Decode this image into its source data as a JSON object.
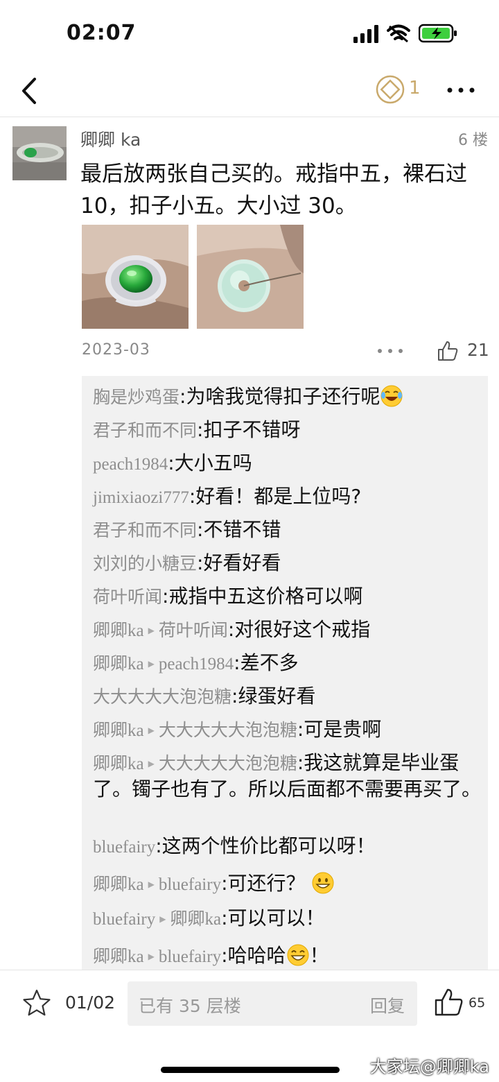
{
  "status": {
    "time": "02:07"
  },
  "nav": {
    "coin_count": "1"
  },
  "post": {
    "username": "卿卿 ka",
    "floor": "6 楼",
    "text": "最后放两张自己买的。戒指中五，裸石过 10，扣子小五。大小过 30。",
    "date": "2023-03",
    "likes": "21"
  },
  "replies": [
    {
      "from": "胸是炒鸡蛋",
      "to": "",
      "text": "为啥我觉得扣子还行呢",
      "emoji": "laugh-cry"
    },
    {
      "from": "君子和而不同",
      "to": "",
      "text": "扣子不错呀",
      "emoji": ""
    },
    {
      "from": "peach1984",
      "to": "",
      "text": "大小五吗",
      "emoji": ""
    },
    {
      "from": "jimixiaozi777",
      "to": "",
      "text": "好看！都是上位吗?",
      "emoji": ""
    },
    {
      "from": "君子和而不同",
      "to": "",
      "text": "不错不错",
      "emoji": ""
    },
    {
      "from": "刘刘的小糖豆",
      "to": "",
      "text": "好看好看",
      "emoji": ""
    },
    {
      "from": "荷叶听闻",
      "to": "",
      "text": "戒指中五这价格可以啊",
      "emoji": ""
    },
    {
      "from": "卿卿ka",
      "to": "荷叶听闻",
      "text": "对很好这个戒指",
      "emoji": ""
    },
    {
      "from": "卿卿ka",
      "to": "peach1984",
      "text": "差不多",
      "emoji": ""
    },
    {
      "from": "大大大大大泡泡糖",
      "to": "",
      "text": "绿蛋好看",
      "emoji": ""
    },
    {
      "from": "卿卿ka",
      "to": "大大大大大泡泡糖",
      "text": "可是贵啊",
      "emoji": ""
    },
    {
      "from": "卿卿ka",
      "to": "大大大大大泡泡糖",
      "text": "我这就算是毕业蛋了。镯子也有了。所以后面都不需要再买了。",
      "emoji": ""
    },
    {
      "from": "bluefairy",
      "to": "",
      "text": "这两个性价比都可以呀！",
      "emoji": ""
    },
    {
      "from": "卿卿ka",
      "to": "bluefairy",
      "text": "可还行？",
      "emoji": "grin"
    },
    {
      "from": "bluefairy",
      "to": "卿卿ka",
      "text": "可以可以！",
      "emoji": ""
    },
    {
      "from": "卿卿ka",
      "to": "bluefairy",
      "text": "哈哈哈",
      "emoji": "smile",
      "after": "！"
    }
  ],
  "bottom": {
    "page": "01/02",
    "placeholder": "已有 35 层楼",
    "reply_button": "回复",
    "likes": "65"
  },
  "watermark": "大家坛@卿卿ka",
  "colors": {
    "accent_gold": "#c9a96b",
    "reply_bg": "#f1f1f1",
    "name_gray": "#8e8e8e"
  }
}
